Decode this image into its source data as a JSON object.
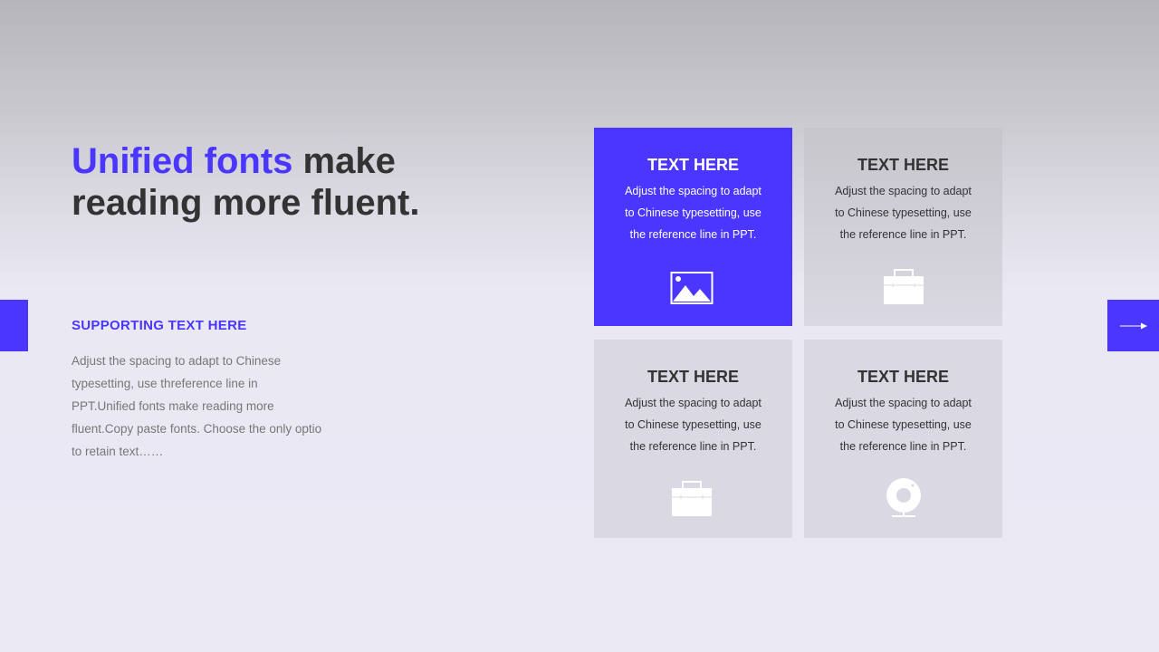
{
  "headline": {
    "accent": "Unified fonts",
    "rest_line1": " make",
    "line2": "reading more fluent."
  },
  "supporting": {
    "title": "SUPPORTING  TEXT HERE",
    "lines": [
      "Adjust the spacing to adapt to Chinese",
      "typesetting, use threference line in",
      "PPT.Unified fonts make reading more",
      "fluent.Copy paste fonts. Choose the only optio",
      "to retain text……"
    ]
  },
  "cards": [
    {
      "title": "TEXT HERE",
      "lines": [
        "Adjust the spacing to adapt",
        "to Chinese  typesetting, use",
        "the reference line in PPT."
      ],
      "icon": "image-icon"
    },
    {
      "title": "TEXT HERE",
      "lines": [
        "Adjust the spacing to adapt",
        "to Chinese  typesetting, use",
        "the reference line in PPT."
      ],
      "icon": "briefcase-icon"
    },
    {
      "title": "TEXT HERE",
      "lines": [
        "Adjust the spacing to adapt",
        "to Chinese  typesetting, use",
        "the reference line in PPT."
      ],
      "icon": "briefcase-icon"
    },
    {
      "title": "TEXT HERE",
      "lines": [
        "Adjust the spacing to adapt",
        "to Chinese  typesetting, use",
        "the reference line in PPT."
      ],
      "icon": "webcam-icon"
    }
  ],
  "colors": {
    "accent": "#4a36ff",
    "heading": "#333333",
    "body": "#777777",
    "card_gray": "#dad8e2"
  }
}
